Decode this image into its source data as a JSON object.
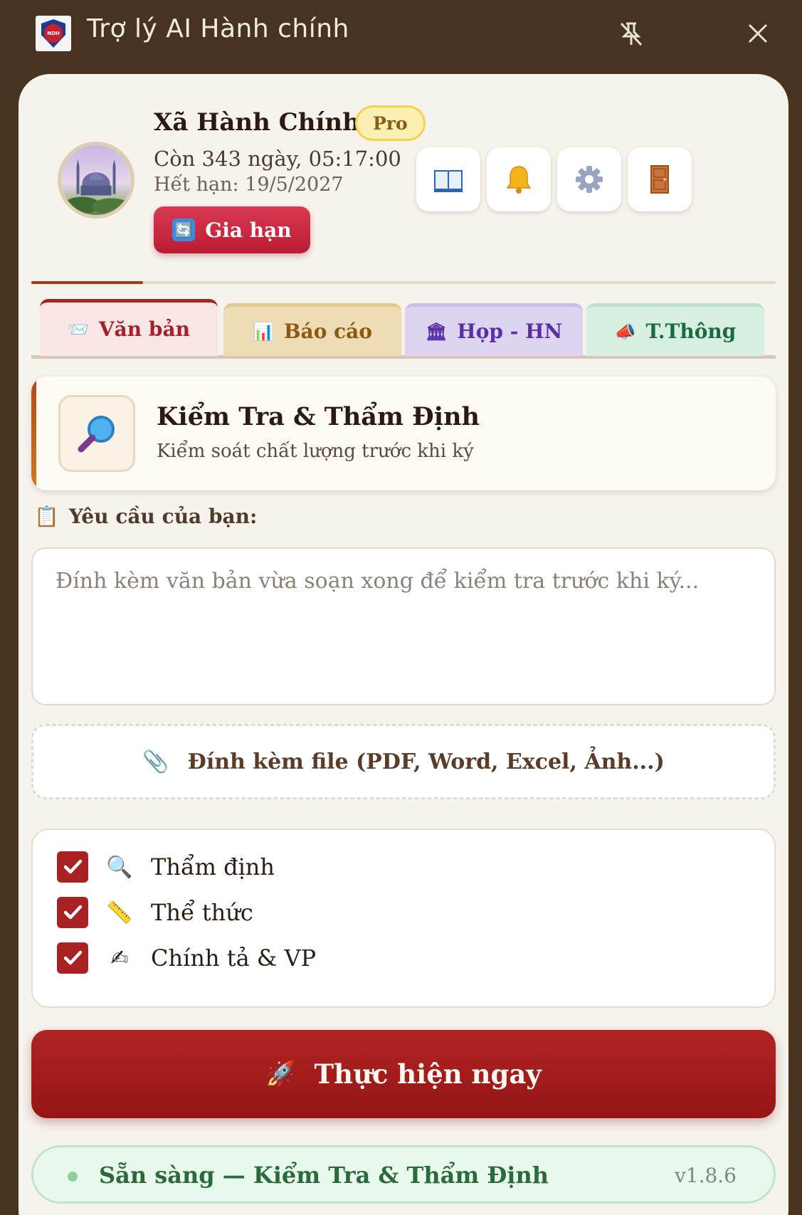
{
  "window": {
    "title": "Trợ lý AI Hành chính",
    "logo_text": "NDH"
  },
  "profile": {
    "name": "Xã Hành Chính",
    "plan_badge": "Pro",
    "days_left": "Còn 343 ngày, 05:17:00",
    "expiry": "Hết hạn: 19/5/2027",
    "renew_label": "Gia hạn",
    "renew_icon": "🔄"
  },
  "toolbar_icons": [
    "book-icon",
    "bell-icon",
    "gear-icon",
    "door-icon"
  ],
  "progress": {
    "fraction": 0.15,
    "color": "#a53a1a"
  },
  "tabs": [
    {
      "icon": "📨",
      "label": "Văn bản",
      "active": true
    },
    {
      "icon": "📊",
      "label": "Báo cáo",
      "active": false
    },
    {
      "icon": "🏛",
      "label": "Họp - HN",
      "active": false
    },
    {
      "icon": "📣",
      "label": "T.Thông",
      "active": false
    }
  ],
  "feature": {
    "title": "Kiểm Tra & Thẩm Định",
    "subtitle": "Kiểm soát chất lượng trước khi ký"
  },
  "request": {
    "label_icon": "📋",
    "label": "Yêu cầu của bạn:",
    "placeholder": "Đính kèm văn bản vừa soạn xong để kiểm tra trước khi ký...",
    "value": ""
  },
  "attach": {
    "icon": "📎",
    "label": "Đính kèm file (PDF, Word, Excel, Ảnh...)"
  },
  "options": [
    {
      "icon": "🔍",
      "label": "Thẩm định",
      "checked": true
    },
    {
      "icon": "📏",
      "label": "Thể thức",
      "checked": true
    },
    {
      "icon": "✍",
      "label": "Chính tả & VP",
      "checked": true
    }
  ],
  "run": {
    "icon": "🚀",
    "label": "Thực hiện ngay"
  },
  "status": {
    "text": "Sẵn sàng — Kiểm Tra & Thẩm Định",
    "version": "v1.8.6"
  },
  "colors": {
    "accent": "#a32525",
    "background": "#47331f",
    "card": "#f6f2ec",
    "status_green": "#2b6a3b"
  }
}
